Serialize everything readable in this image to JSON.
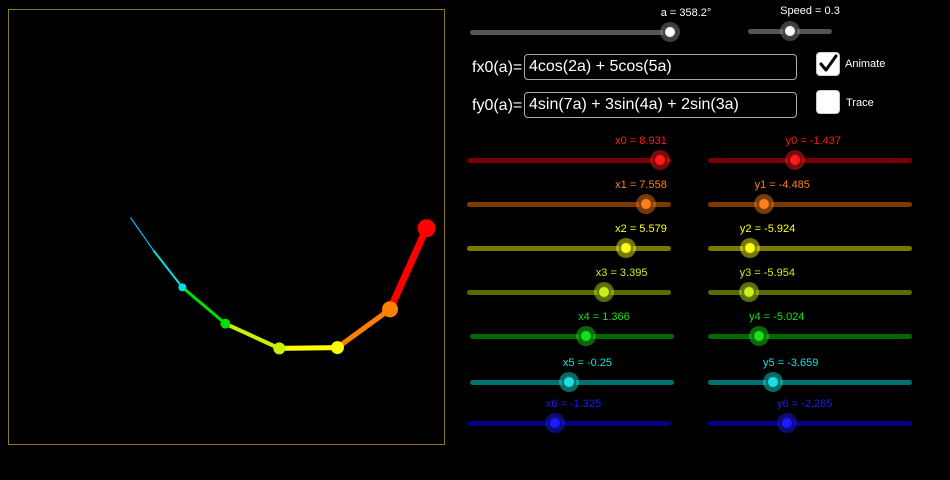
{
  "top_sliders": {
    "angle": {
      "label": "a = 358.2°",
      "fraction": 0.995
    },
    "speed": {
      "label": "Speed = 0.3",
      "fraction": 0.5
    }
  },
  "inputs": {
    "fx": {
      "label": "fx0(a)=",
      "value": "4cos(2a) + 5cos(5a)"
    },
    "fy": {
      "label": "fy0(a)=",
      "value": "4sin(7a) + 3sin(4a) + 2sin(3a)"
    }
  },
  "checkboxes": {
    "animate": {
      "label": "Animate",
      "checked": true
    },
    "trace": {
      "label": "Trace",
      "checked": false
    }
  },
  "x_sliders": [
    {
      "label": "x0 = 8.931",
      "value": 8.931,
      "color": "#ff1a1a",
      "track": "#7a0000"
    },
    {
      "label": "x1 = 7.558",
      "value": 7.558,
      "color": "#ff7f1a",
      "track": "#7a3a00"
    },
    {
      "label": "x2 = 5.579",
      "value": 5.579,
      "color": "#ffff1a",
      "track": "#7a7a00"
    },
    {
      "label": "x3 = 3.395",
      "value": 3.395,
      "color": "#c8f01a",
      "track": "#5a6a00"
    },
    {
      "label": "x4 = 1.366",
      "value": 1.366,
      "color": "#1ae01a",
      "track": "#006a00"
    },
    {
      "label": "x5 = -0.25",
      "value": -0.25,
      "color": "#1ae0e0",
      "track": "#007070"
    },
    {
      "label": "x6 = -1.325",
      "value": -1.325,
      "color": "#1a1aff",
      "track": "#000080"
    }
  ],
  "y_sliders": [
    {
      "label": "y0 = -1.437",
      "value": -1.437,
      "color": "#ff1a1a",
      "track": "#7a0000"
    },
    {
      "label": "y1 = -4.485",
      "value": -4.485,
      "color": "#ff7f1a",
      "track": "#7a3a00"
    },
    {
      "label": "y2 = -5.924",
      "value": -5.924,
      "color": "#ffff1a",
      "track": "#7a7a00"
    },
    {
      "label": "y3 = -5.954",
      "value": -5.954,
      "color": "#c8f01a",
      "track": "#5a6a00"
    },
    {
      "label": "y4 = -5.024",
      "value": -5.024,
      "color": "#1ae01a",
      "track": "#006a00"
    },
    {
      "label": "y5 = -3.659",
      "value": -3.659,
      "color": "#1ae0e0",
      "track": "#007070"
    },
    {
      "label": "y6 = -2.285",
      "value": -2.285,
      "color": "#1a1aff",
      "track": "#000080"
    }
  ],
  "chain_colors": [
    "#ff0000",
    "#ff7f00",
    "#ffff00",
    "#c8f000",
    "#00e000",
    "#00e0e0",
    "#00c0ff"
  ]
}
